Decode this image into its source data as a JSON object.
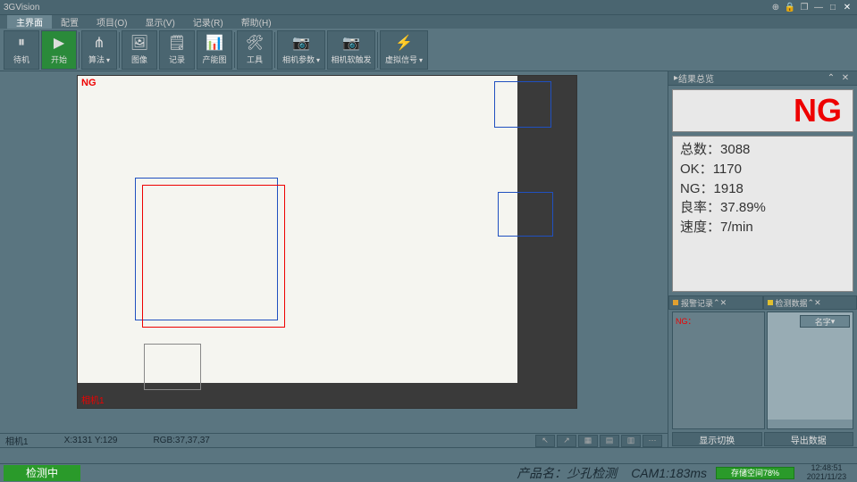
{
  "app_title": "3GVision",
  "menu": [
    "主界面",
    "配置",
    "项目(O)",
    "显示(V)",
    "记录(R)",
    "帮助(H)"
  ],
  "menu_active_index": 0,
  "toolbar": [
    {
      "label": "待机",
      "icon": "⏸"
    },
    {
      "label": "开始",
      "icon": "▶",
      "green": true
    },
    {
      "label": "算法",
      "icon": "⋔",
      "dropdown": true
    },
    {
      "label": "图像",
      "icon": "🖼"
    },
    {
      "label": "记录",
      "icon": "🗒"
    },
    {
      "label": "产能图",
      "icon": "📊"
    },
    {
      "label": "工具",
      "icon": "🛠"
    },
    {
      "label": "相机参数",
      "icon": "📷",
      "dropdown": true,
      "wide": true
    },
    {
      "label": "相机软触发",
      "icon": "📷",
      "wide": true
    },
    {
      "label": "虚拟信号",
      "icon": "⚡",
      "dropdown": true,
      "wide": true
    }
  ],
  "right_header": "结果总览",
  "result": "NG",
  "stats": {
    "total_label": "总数：",
    "total": 3088,
    "ok_label": "OK：",
    "ok": 1170,
    "ng_label": "NG：",
    "ng": 1918,
    "yield_label": "良率：",
    "yield": "37.89%",
    "speed_label": "速度：",
    "speed": "7/min"
  },
  "alarm_head": "报警记录",
  "data_head": "检测数据",
  "alarm_text": "NG：",
  "data_dropdown": "名字",
  "bottom_buttons": [
    "显示切换",
    "导出数据"
  ],
  "viewport": {
    "ng": "NG",
    "camera": "相机1"
  },
  "status": {
    "camera": "相机1",
    "pos": "X:3131 Y:129",
    "rgb": "RGB:37,37,37"
  },
  "footer": {
    "running": "检测中",
    "product_label": "产品名：",
    "product": "少孔检测",
    "cam": "CAM1:183ms",
    "save": "存储空间78%",
    "time": "12:48:51",
    "date": "2021/11/23"
  }
}
